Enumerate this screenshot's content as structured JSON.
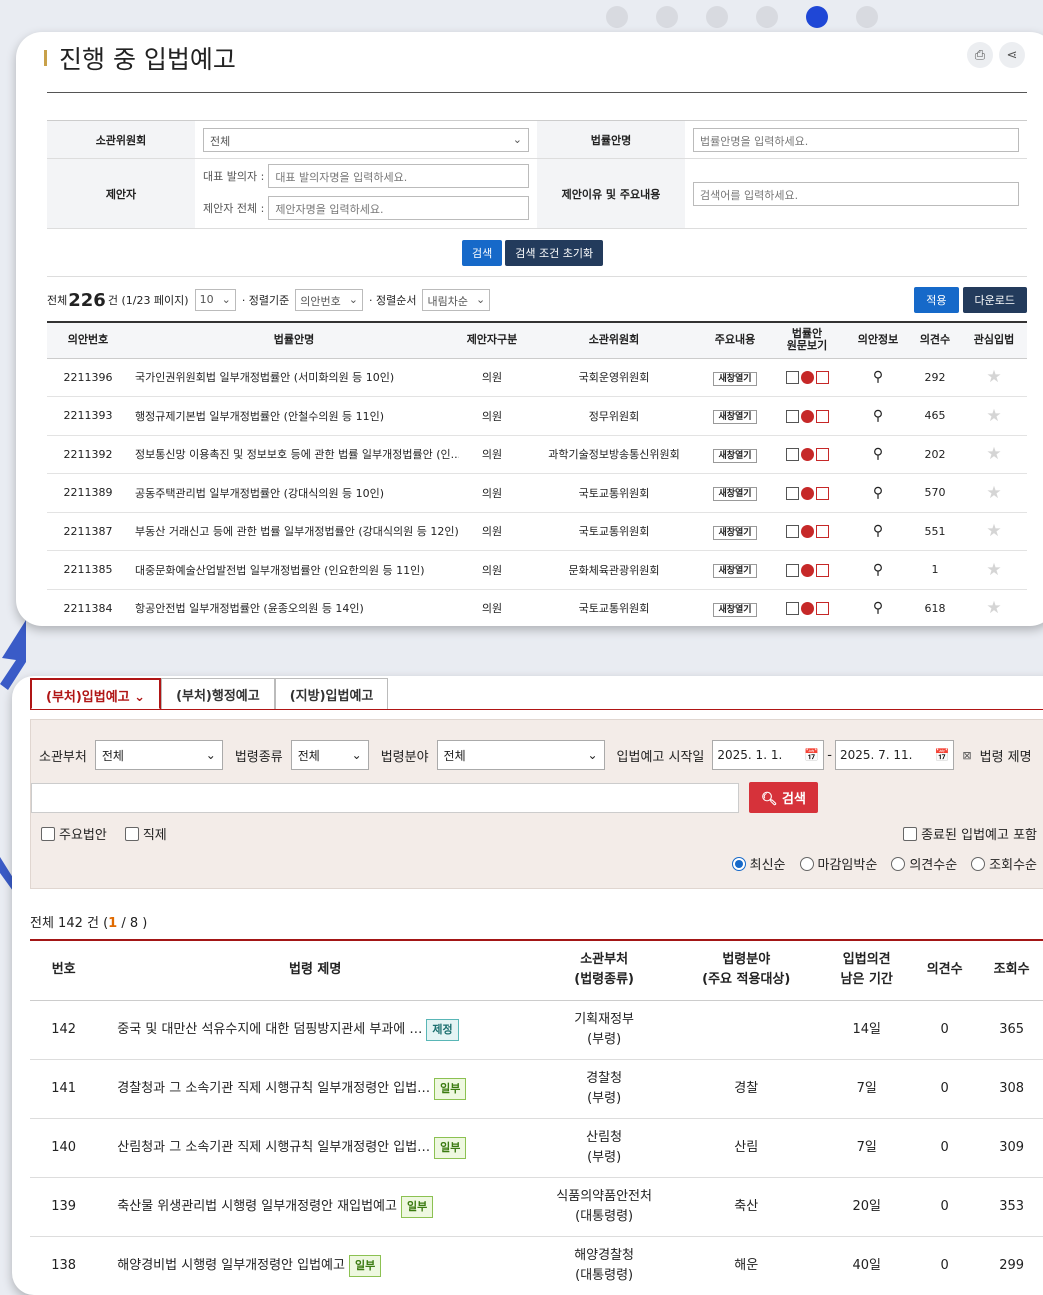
{
  "colors": {
    "accent_blue": "#1669c9",
    "dark_navy": "#233b5c",
    "red": "#d6323a",
    "tab_red": "#b01515",
    "dot_active": "#1f47d6"
  },
  "carousel": {
    "dot_count": 6,
    "active_index": 4
  },
  "panel1": {
    "title": "진행 중 입법예고",
    "icons": [
      "print-icon",
      "share-icon"
    ],
    "search": {
      "committee_label": "소관위원회",
      "committee_value": "전체",
      "bill_name_label": "법률안명",
      "bill_name_placeholder": "법률안명을 입력하세요.",
      "proposer_label": "제안자",
      "rep_label": "대표 발의자 :",
      "rep_placeholder": "대표 발의자명을 입력하세요.",
      "all_label": "제안자 전체 :",
      "all_placeholder": "제안자명을 입력하세요.",
      "reason_label": "제안이유 및 주요내용",
      "reason_placeholder": "검색어를 입력하세요.",
      "search_btn": "검색",
      "reset_btn": "검색 조건 초기화"
    },
    "toolbar": {
      "total_prefix": "전체",
      "total": "226",
      "total_suffix": "건 (1/23 페이지)",
      "per_page": "10",
      "sort_label": "· 정렬기준",
      "sort_value": "의안번호",
      "order_label": "· 정렬순서",
      "order_value": "내림차순",
      "apply_btn": "적용",
      "download_btn": "다운로드"
    },
    "columns": [
      "의안번호",
      "법률안명",
      "제안자구분",
      "소관위원회",
      "주요내용",
      "법률안\n원문보기",
      "의안정보",
      "의견수",
      "관심입법"
    ],
    "rows": [
      {
        "no": "2211396",
        "name": "국가인권위원회법 일부개정법률안 (서미화의원 등 10인)",
        "type": "의원",
        "committee": "국회운영위원회",
        "btn": "새창열기",
        "count": "292"
      },
      {
        "no": "2211393",
        "name": "행정규제기본법 일부개정법률안 (안철수의원 등 11인)",
        "type": "의원",
        "committee": "정무위원회",
        "btn": "새창열기",
        "count": "465"
      },
      {
        "no": "2211392",
        "name": "정보통신망 이용촉진 및 정보보호 등에 관한 법률 일부개정법률안 (인...",
        "type": "의원",
        "committee": "과학기술정보방송통신위원회",
        "btn": "새창열기",
        "count": "202"
      },
      {
        "no": "2211389",
        "name": "공동주택관리법 일부개정법률안 (강대식의원 등 10인)",
        "type": "의원",
        "committee": "국토교통위원회",
        "btn": "새창열기",
        "count": "570"
      },
      {
        "no": "2211387",
        "name": "부동산 거래신고 등에 관한 법률 일부개정법률안 (강대식의원 등 12인)",
        "type": "의원",
        "committee": "국토교통위원회",
        "btn": "새창열기",
        "count": "551"
      },
      {
        "no": "2211385",
        "name": "대중문화예술산업발전법 일부개정법률안 (인요한의원 등 11인)",
        "type": "의원",
        "committee": "문화체육관광위원회",
        "btn": "새창열기",
        "count": "1"
      },
      {
        "no": "2211384",
        "name": "항공안전법 일부개정법률안 (윤종오의원 등 14인)",
        "type": "의원",
        "committee": "국토교통위원회",
        "btn": "새창열기",
        "count": "618"
      }
    ]
  },
  "panel2": {
    "tabs": [
      "(부처)입법예고 ⌄",
      "(부처)행정예고",
      "(지방)입법예고"
    ],
    "filter": {
      "ministry_label": "소관부처",
      "ministry_value": "전체",
      "law_type_label": "법령종류",
      "law_type_value": "전체",
      "field_label": "법령분야",
      "field_value": "전체",
      "start_label": "입법예고 시작일",
      "date_from": "2025. 1. 1.",
      "date_sep": "-",
      "date_to": "2025. 7. 11.",
      "title_label": "법령 제명",
      "search_btn": "검색",
      "chk_major": "주요법안",
      "chk_new": "직제",
      "chk_ended": "종료된 입법예고 포함",
      "radios": [
        "최신순",
        "마감임박순",
        "의견수순",
        "조회수순"
      ]
    },
    "count": {
      "prefix": "전체 142 건 (",
      "current": "1",
      "rest": " / 8 )"
    },
    "columns": {
      "no": "번호",
      "title": "법령 제명",
      "ministry": "소관부처",
      "ministry_sub": "(법령종류)",
      "field": "법령분야",
      "field_sub": "(주요 적용대상)",
      "remain": "입법의견",
      "remain_sub": "남은 기간",
      "opinions": "의견수",
      "views": "조회수"
    },
    "rows": [
      {
        "no": "142",
        "title": "중국 및 대만산 석유수지에 대한 덤핑방지관세 부과에 …",
        "badge": "제정",
        "ministry": "기획재정부",
        "kind": "(부령)",
        "field": "",
        "remain": "14일",
        "opinions": "0",
        "views": "365"
      },
      {
        "no": "141",
        "title": "경찰청과 그 소속기관 직제 시행규칙 일부개정령안 입법…",
        "badge": "일부",
        "ministry": "경찰청",
        "kind": "(부령)",
        "field": "경찰",
        "remain": "7일",
        "opinions": "0",
        "views": "308"
      },
      {
        "no": "140",
        "title": "산림청과 그 소속기관 직제 시행규칙 일부개정령안 입법…",
        "badge": "일부",
        "ministry": "산림청",
        "kind": "(부령)",
        "field": "산림",
        "remain": "7일",
        "opinions": "0",
        "views": "309"
      },
      {
        "no": "139",
        "title": "축산물 위생관리법 시행령 일부개정령안 재입법예고",
        "badge": "일부",
        "ministry": "식품의약품안전처",
        "kind": "(대통령령)",
        "field": "축산",
        "remain": "20일",
        "opinions": "0",
        "views": "353"
      },
      {
        "no": "138",
        "title": "해양경비법 시행령 일부개정령안 입법예고",
        "badge": "일부",
        "ministry": "해양경찰청",
        "kind": "(대통령령)",
        "field": "해운",
        "remain": "40일",
        "opinions": "0",
        "views": "299"
      }
    ]
  }
}
